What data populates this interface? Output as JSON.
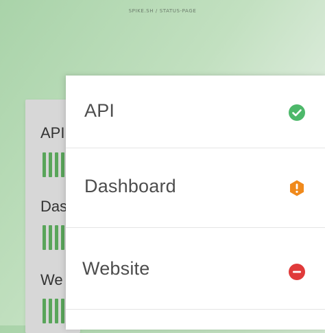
{
  "brand": "SPIKE.SH / STATUS-PAGE",
  "back_card": {
    "items": [
      {
        "label": "API"
      },
      {
        "label": "Das"
      },
      {
        "label": "We"
      }
    ]
  },
  "services": [
    {
      "name": "API",
      "status": "operational",
      "icon": "check-circle-icon",
      "color": "#4db86a"
    },
    {
      "name": "Dashboard",
      "status": "warning",
      "icon": "exclamation-hexagon-icon",
      "color": "#f08a1c"
    },
    {
      "name": "Website",
      "status": "down",
      "icon": "minus-circle-icon",
      "color": "#e03a3a"
    }
  ]
}
